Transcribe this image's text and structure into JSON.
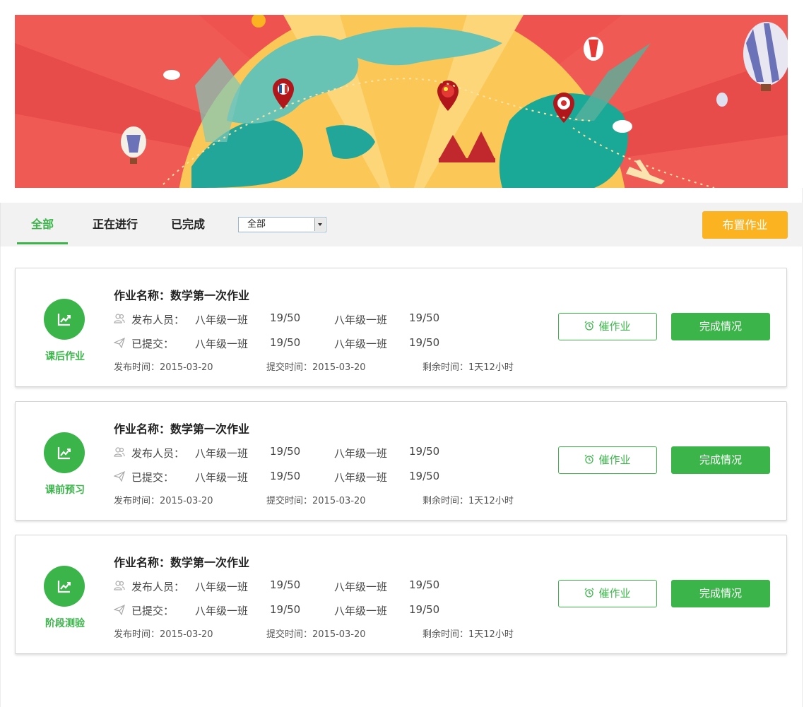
{
  "toolbar": {
    "tabs": [
      {
        "label": "全部",
        "active": true
      },
      {
        "label": "正在进行",
        "active": false
      },
      {
        "label": "已完成",
        "active": false
      }
    ],
    "filter_value": "全部",
    "assign_label": "布置作业"
  },
  "colors": {
    "accent_green": "#3bb54a",
    "accent_orange": "#fbb321",
    "banner_red": "#ef5350"
  },
  "cards": [
    {
      "type_icon": "trend-chart-icon",
      "type_label": "课后作业",
      "title": "作业名称：数学第一次作业",
      "publisher_label": "发布人员：",
      "submitted_label": "已提交：",
      "row1": [
        "八年级一班",
        "19/50",
        "八年级一班",
        "19/50"
      ],
      "row2": [
        "八年级一班",
        "19/50",
        "八年级一班",
        "19/50"
      ],
      "publish_time": "发布时间：2015-03-20",
      "submit_time": "提交时间：2015-03-20",
      "remaining_time": "剩余时间：1天12小时",
      "urge_label": "催作业",
      "status_label": "完成情况"
    },
    {
      "type_icon": "trend-chart-icon",
      "type_label": "课前预习",
      "title": "作业名称：数学第一次作业",
      "publisher_label": "发布人员：",
      "submitted_label": "已提交：",
      "row1": [
        "八年级一班",
        "19/50",
        "八年级一班",
        "19/50"
      ],
      "row2": [
        "八年级一班",
        "19/50",
        "八年级一班",
        "19/50"
      ],
      "publish_time": "发布时间：2015-03-20",
      "submit_time": "提交时间：2015-03-20",
      "remaining_time": "剩余时间：1天12小时",
      "urge_label": "催作业",
      "status_label": "完成情况"
    },
    {
      "type_icon": "trend-chart-icon",
      "type_label": "阶段测验",
      "title": "作业名称：数学第一次作业",
      "publisher_label": "发布人员：",
      "submitted_label": "已提交：",
      "row1": [
        "八年级一班",
        "19/50",
        "八年级一班",
        "19/50"
      ],
      "row2": [
        "八年级一班",
        "19/50",
        "八年级一班",
        "19/50"
      ],
      "publish_time": "发布时间：2015-03-20",
      "submit_time": "提交时间：2015-03-20",
      "remaining_time": "剩余时间：1天12小时",
      "urge_label": "催作业",
      "status_label": "完成情况"
    }
  ]
}
